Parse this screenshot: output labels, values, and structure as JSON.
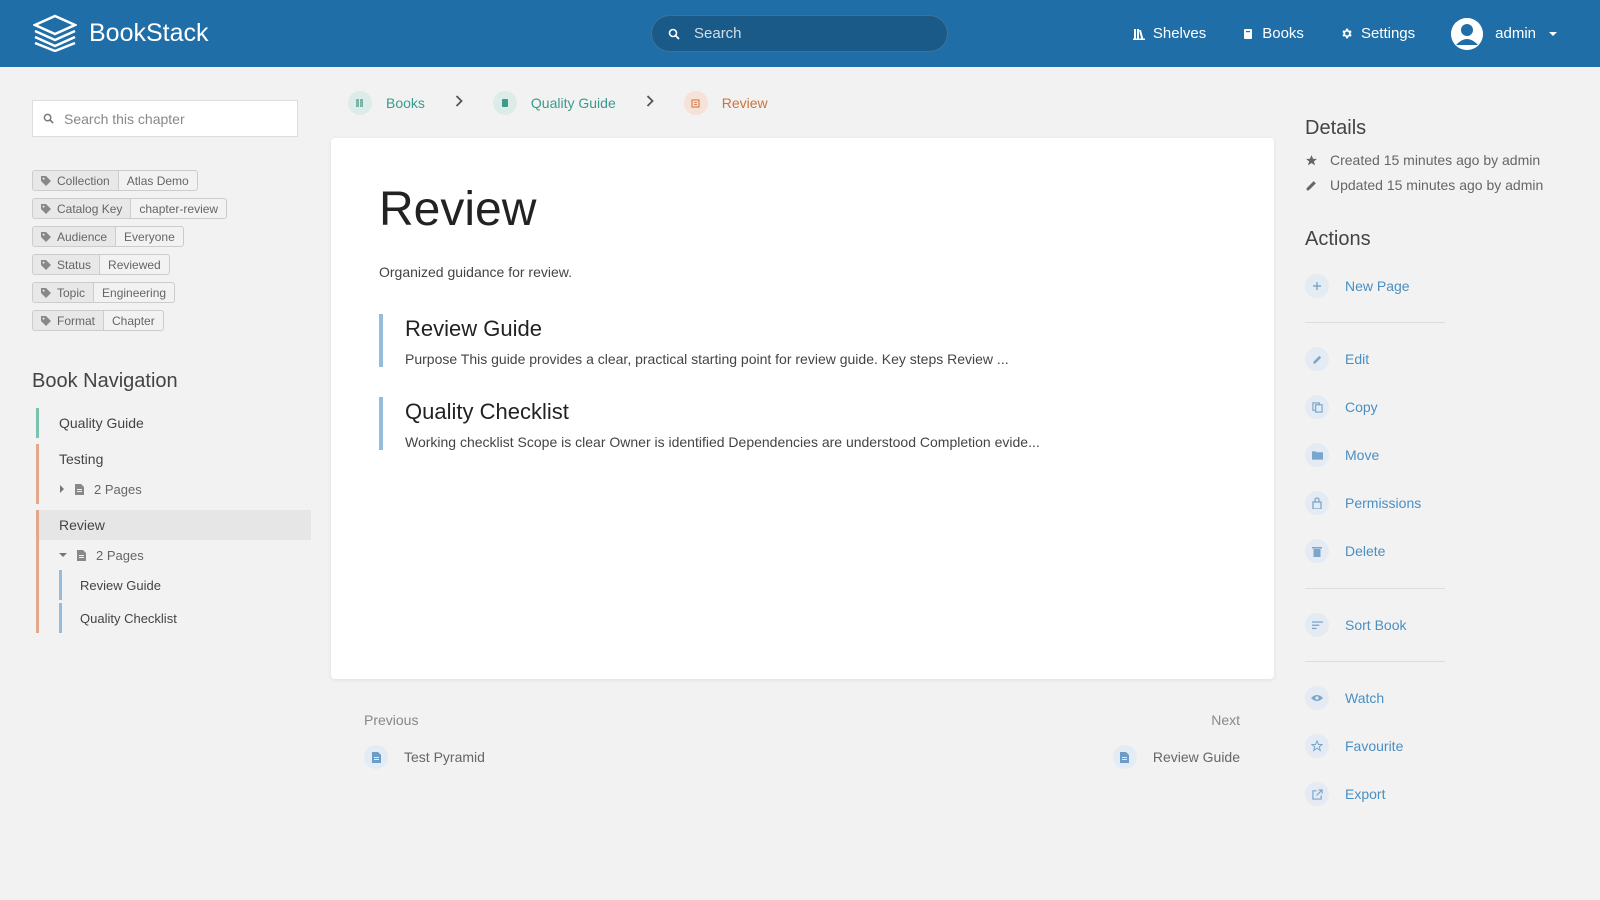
{
  "header": {
    "app_name": "BookStack",
    "search_placeholder": "Search",
    "nav": [
      {
        "label": "Shelves",
        "icon": "shelves-icon"
      },
      {
        "label": "Books",
        "icon": "books-icon"
      },
      {
        "label": "Settings",
        "icon": "gear-icon"
      }
    ],
    "user": "admin"
  },
  "sidebar": {
    "search_placeholder": "Search this chapter",
    "tags": [
      {
        "name": "Collection",
        "value": "Atlas Demo"
      },
      {
        "name": "Catalog Key",
        "value": "chapter-review"
      },
      {
        "name": "Audience",
        "value": "Everyone"
      },
      {
        "name": "Status",
        "value": "Reviewed"
      },
      {
        "name": "Topic",
        "value": "Engineering"
      },
      {
        "name": "Format",
        "value": "Chapter"
      }
    ],
    "nav_title": "Book Navigation",
    "book": "Quality Guide",
    "chapters": [
      {
        "label": "Testing",
        "pages_label": "2 Pages"
      },
      {
        "label": "Review",
        "pages_label": "2 Pages",
        "pages": [
          "Review Guide",
          "Quality Checklist"
        ]
      }
    ]
  },
  "breadcrumb": [
    {
      "label": "Books"
    },
    {
      "label": "Quality Guide"
    },
    {
      "label": "Review"
    }
  ],
  "main": {
    "title": "Review",
    "description": "Organized guidance for review.",
    "entries": [
      {
        "title": "Review Guide",
        "excerpt": "Purpose This guide provides a clear, practical starting point for review guide. Key steps Review ..."
      },
      {
        "title": "Quality Checklist",
        "excerpt": "Working checklist Scope is clear Owner is identified Dependencies are understood Completion evide..."
      }
    ]
  },
  "pager": {
    "previous_label": "Previous",
    "previous_title": "Test Pyramid",
    "next_label": "Next",
    "next_title": "Review Guide"
  },
  "details": {
    "title": "Details",
    "created": "Created 15 minutes ago by admin",
    "updated": "Updated 15 minutes ago by admin"
  },
  "actions": {
    "title": "Actions",
    "new_page": "New Page",
    "edit": "Edit",
    "copy": "Copy",
    "move": "Move",
    "permissions": "Permissions",
    "delete": "Delete",
    "sort_book": "Sort Book",
    "watch": "Watch",
    "favourite": "Favourite",
    "export": "Export"
  },
  "colors": {
    "header": "#206ea7",
    "book": "#077b70",
    "chapter": "#af4d0d",
    "page": "#206ea7"
  }
}
